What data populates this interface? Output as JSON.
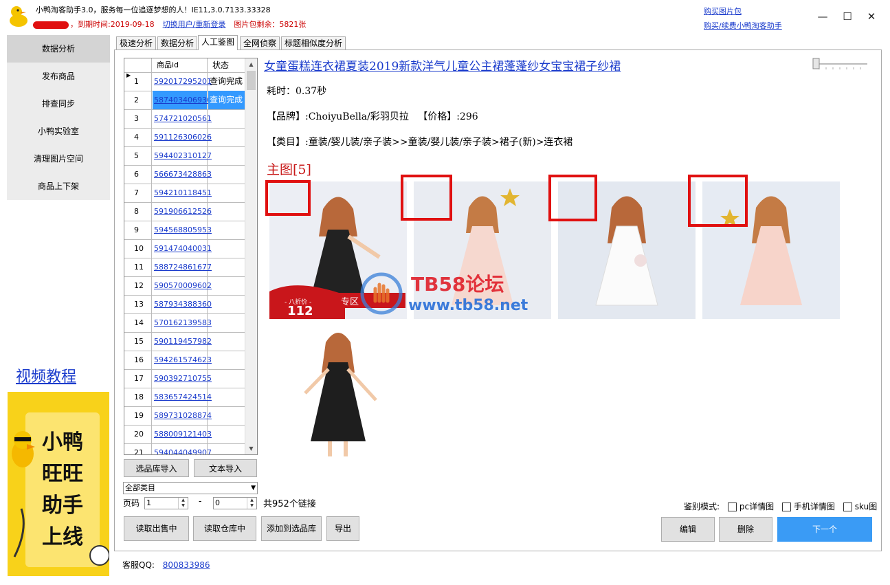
{
  "header": {
    "app_title": "小鸭淘客助手3.0，服务每一位追逐梦想的人！IE11,3.0.7133.33328",
    "expire_label": "，到期时间:2019-09-18",
    "switch_user": "切换用户/重新登录",
    "pic_remaining": "图片包剩余：5821张",
    "buy_pic": "购买图片包",
    "buy_renew": "购买/续费小鸭淘客助手",
    "minimize": "—",
    "maximize": "☐",
    "close": "✕"
  },
  "sidebar": {
    "items": [
      {
        "label": "数据分析"
      },
      {
        "label": "发布商品"
      },
      {
        "label": "排查同步"
      },
      {
        "label": "小鸭实验室"
      },
      {
        "label": "清理图片空间"
      },
      {
        "label": "商品上下架"
      }
    ],
    "video_link": "视频教程",
    "banner_lines": [
      "小鸭",
      "旺旺",
      "助手",
      "上线"
    ]
  },
  "tabs": [
    {
      "label": "极速分析"
    },
    {
      "label": "数据分析"
    },
    {
      "label": "人工鉴图"
    },
    {
      "label": "全网侦察"
    },
    {
      "label": "标题相似度分析"
    }
  ],
  "table": {
    "headers": [
      "",
      "商品id",
      "状态"
    ],
    "rows": [
      {
        "no": "1",
        "id": "592017295201",
        "status": "查询完成"
      },
      {
        "no": "2",
        "id": "587403406936",
        "status": "查询完成"
      },
      {
        "no": "3",
        "id": "574721020561",
        "status": ""
      },
      {
        "no": "4",
        "id": "591126306026",
        "status": ""
      },
      {
        "no": "5",
        "id": "594402310127",
        "status": ""
      },
      {
        "no": "6",
        "id": "566673428863",
        "status": ""
      },
      {
        "no": "7",
        "id": "594210118451",
        "status": ""
      },
      {
        "no": "8",
        "id": "591906612526",
        "status": ""
      },
      {
        "no": "9",
        "id": "594568805953",
        "status": ""
      },
      {
        "no": "10",
        "id": "591474040031",
        "status": ""
      },
      {
        "no": "11",
        "id": "588724861677",
        "status": ""
      },
      {
        "no": "12",
        "id": "590570009602",
        "status": ""
      },
      {
        "no": "13",
        "id": "587934388360",
        "status": ""
      },
      {
        "no": "14",
        "id": "570162139583",
        "status": ""
      },
      {
        "no": "15",
        "id": "590119457982",
        "status": ""
      },
      {
        "no": "16",
        "id": "594261574623",
        "status": ""
      },
      {
        "no": "17",
        "id": "590392710755",
        "status": ""
      },
      {
        "no": "18",
        "id": "583657424514",
        "status": ""
      },
      {
        "no": "19",
        "id": "589731028874",
        "status": ""
      },
      {
        "no": "20",
        "id": "588009121403",
        "status": ""
      },
      {
        "no": "21",
        "id": "594044049907",
        "status": ""
      }
    ]
  },
  "controls": {
    "import_lib": "选品库导入",
    "import_text": "文本导入",
    "category": "全部类目",
    "page_label": "页码",
    "page_from": "1",
    "dash": "-",
    "page_to": "0",
    "total": "共952个链接",
    "read_sale": "读取出售中",
    "read_stock": "读取仓库中",
    "add_lib": "添加到选品库",
    "export": "导出"
  },
  "product": {
    "title": "女童蛋糕连衣裙夏装2019新款洋气儿童公主裙蓬蓬纱女宝宝裙子纱裙",
    "elapsed": "耗时：0.37秒",
    "brand_price": "【品牌】:ChoiyuBella/彩羽贝拉   【价格】:296",
    "category_path": "【类目】:童装/婴儿装/亲子装>>童装/婴儿装/亲子装>裙子(新)>连衣裙",
    "main_images": "主图[5]",
    "promo_label": "- 八折价 -",
    "promo_price": "112",
    "promo_zone": "专区",
    "watermark_title": "TB58论坛",
    "watermark_url": "www.tb58.net"
  },
  "bottom_right": {
    "mode_label": "鉴别模式:",
    "opt_pc": "pc详情图",
    "opt_mobile": "手机详情图",
    "opt_sku": "sku图",
    "edit": "编辑",
    "delete": "删除",
    "next": "下一个"
  },
  "footer": {
    "qq_label": "客服QQ:",
    "qq_number": "800833986"
  },
  "colors": {
    "accent_blue": "#3a9bf5",
    "link_blue": "#1a3bcc",
    "alert_red": "#e01010",
    "banner_yellow": "#f8d21a"
  }
}
